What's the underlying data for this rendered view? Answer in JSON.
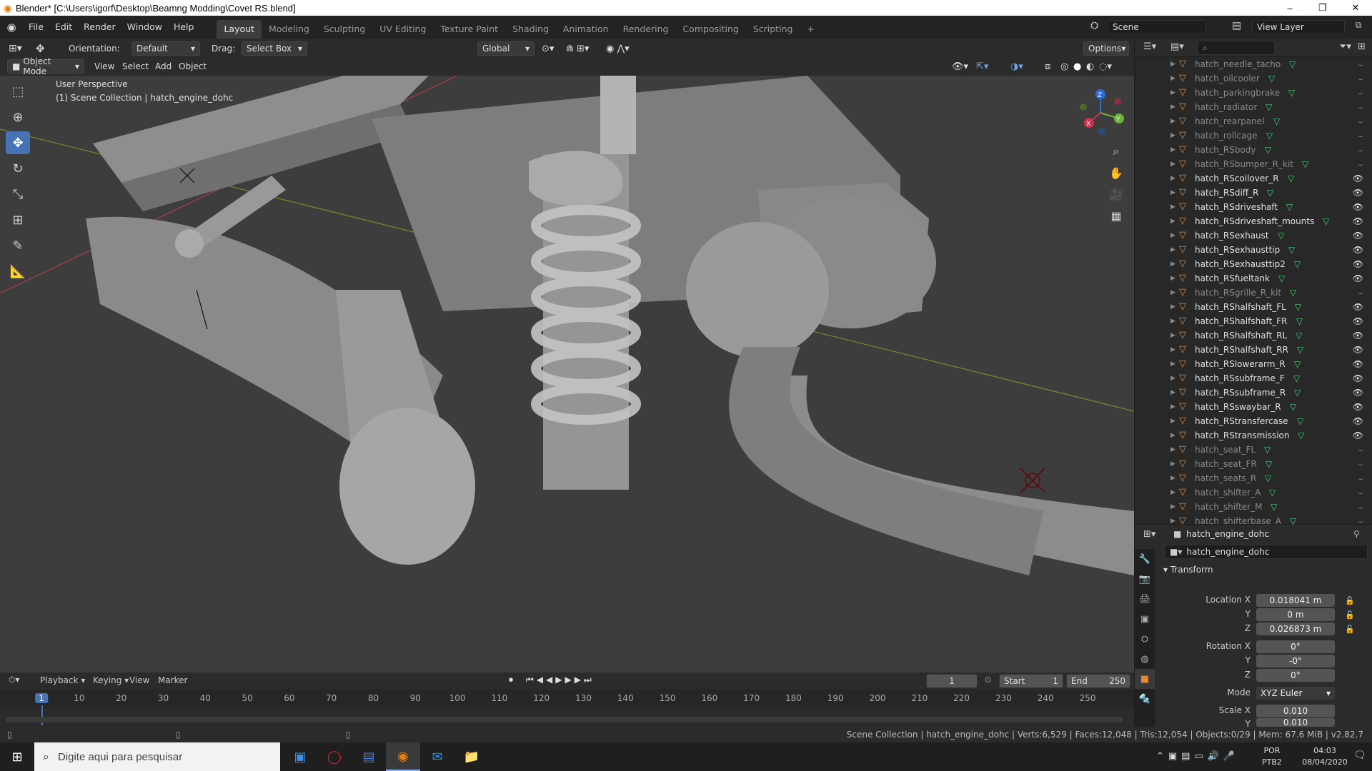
{
  "window": {
    "title": "Blender* [C:\\Users\\igorf\\Desktop\\Beamng Modding\\Covet RS.blend]",
    "minimize": "–",
    "maximize": "❐",
    "close": "✕"
  },
  "menu": [
    "File",
    "Edit",
    "Render",
    "Window",
    "Help"
  ],
  "workspaces": [
    "Layout",
    "Modeling",
    "Sculpting",
    "UV Editing",
    "Texture Paint",
    "Shading",
    "Animation",
    "Rendering",
    "Compositing",
    "Scripting"
  ],
  "workspace_add": "+",
  "scene": {
    "name": "Scene",
    "view_layer": "View Layer"
  },
  "viewport_header": {
    "orientation_label": "Orientation:",
    "orientation_value": "Default",
    "drag_label": "Drag:",
    "drag_value": "Select Box",
    "transform_space": "Global",
    "options": "Options",
    "mode": "Object Mode",
    "view": "View",
    "select": "Select",
    "add": "Add",
    "object": "Object"
  },
  "viewport": {
    "perspective": "User Perspective",
    "collection_info": "(1) Scene Collection | hatch_engine_dohc"
  },
  "gizmo": {
    "x": "X",
    "y": "Y",
    "z": "Z"
  },
  "outliner": {
    "search_placeholder": "",
    "items": [
      {
        "name": "hatch_needle_tacho",
        "dim": true
      },
      {
        "name": "hatch_oilcooler",
        "dim": true
      },
      {
        "name": "hatch_parkingbrake",
        "dim": true
      },
      {
        "name": "hatch_radiator",
        "dim": true
      },
      {
        "name": "hatch_rearpanel",
        "dim": true
      },
      {
        "name": "hatch_rollcage",
        "dim": true
      },
      {
        "name": "hatch_RSbody",
        "dim": true
      },
      {
        "name": "hatch_RSbumper_R_kit",
        "dim": true
      },
      {
        "name": "hatch_RScoilover_R",
        "dim": false
      },
      {
        "name": "hatch_RSdiff_R",
        "dim": false
      },
      {
        "name": "hatch_RSdriveshaft",
        "dim": false
      },
      {
        "name": "hatch_RSdriveshaft_mounts",
        "dim": false
      },
      {
        "name": "hatch_RSexhaust",
        "dim": false
      },
      {
        "name": "hatch_RSexhausttip",
        "dim": false
      },
      {
        "name": "hatch_RSexhausttip2",
        "dim": false
      },
      {
        "name": "hatch_RSfueltank",
        "dim": false
      },
      {
        "name": "hatch_RSgrille_R_kit",
        "dim": true
      },
      {
        "name": "hatch_RShalfshaft_FL",
        "dim": false
      },
      {
        "name": "hatch_RShalfshaft_FR",
        "dim": false
      },
      {
        "name": "hatch_RShalfshaft_RL",
        "dim": false
      },
      {
        "name": "hatch_RShalfshaft_RR",
        "dim": false
      },
      {
        "name": "hatch_RSlowerarm_R",
        "dim": false
      },
      {
        "name": "hatch_RSsubframe_F",
        "dim": false
      },
      {
        "name": "hatch_RSsubframe_R",
        "dim": false
      },
      {
        "name": "hatch_RSswaybar_R",
        "dim": false
      },
      {
        "name": "hatch_RStransfercase",
        "dim": false
      },
      {
        "name": "hatch_RStransmission",
        "dim": false
      },
      {
        "name": "hatch_seat_FL",
        "dim": true
      },
      {
        "name": "hatch_seat_FR",
        "dim": true
      },
      {
        "name": "hatch_seats_R",
        "dim": true
      },
      {
        "name": "hatch_shifter_A",
        "dim": true
      },
      {
        "name": "hatch_shifter_M",
        "dim": true
      },
      {
        "name": "hatch_shifterbase_A",
        "dim": true
      }
    ]
  },
  "properties": {
    "header_object": "hatch_engine_dohc",
    "object_name": "hatch_engine_dohc",
    "panel": "Transform",
    "location_label": "Location X",
    "y_label": "Y",
    "z_label": "Z",
    "location": {
      "x": "0.018041 m",
      "y": "0 m",
      "z": "0.026873 m"
    },
    "rotation_label": "Rotation X",
    "rotation": {
      "x": "0°",
      "y": "-0°",
      "z": "0°"
    },
    "mode_label": "Mode",
    "mode_value": "XYZ Euler",
    "scale_label": "Scale X",
    "scale": {
      "x": "0.010",
      "y": "0.010"
    }
  },
  "timeline": {
    "playback": "Playback",
    "keying": "Keying",
    "view": "View",
    "marker": "Marker",
    "current_frame": "1",
    "start_label": "Start",
    "start": "1",
    "end_label": "End",
    "end": "250",
    "ticks": [
      "1",
      "10",
      "20",
      "30",
      "40",
      "50",
      "60",
      "70",
      "80",
      "90",
      "100",
      "110",
      "120",
      "130",
      "140",
      "150",
      "160",
      "170",
      "180",
      "190",
      "200",
      "210",
      "220",
      "230",
      "240",
      "250"
    ]
  },
  "status": "Scene Collection | hatch_engine_dohc | Verts:6,529 | Faces:12,048 | Tris:12,054 | Objects:0/29 | Mem: 67.6 MiB | v2.82.7",
  "taskbar": {
    "search_placeholder": "Digite aqui para pesquisar",
    "lang1": "POR",
    "lang2": "PTB2",
    "time": "04:03",
    "date": "08/04/2020"
  },
  "colors": {
    "accent": "#4772b3",
    "object_orange": "#e08b37",
    "mesh_green": "#4fc97a",
    "viewport_bg": "#3d3d3d"
  }
}
